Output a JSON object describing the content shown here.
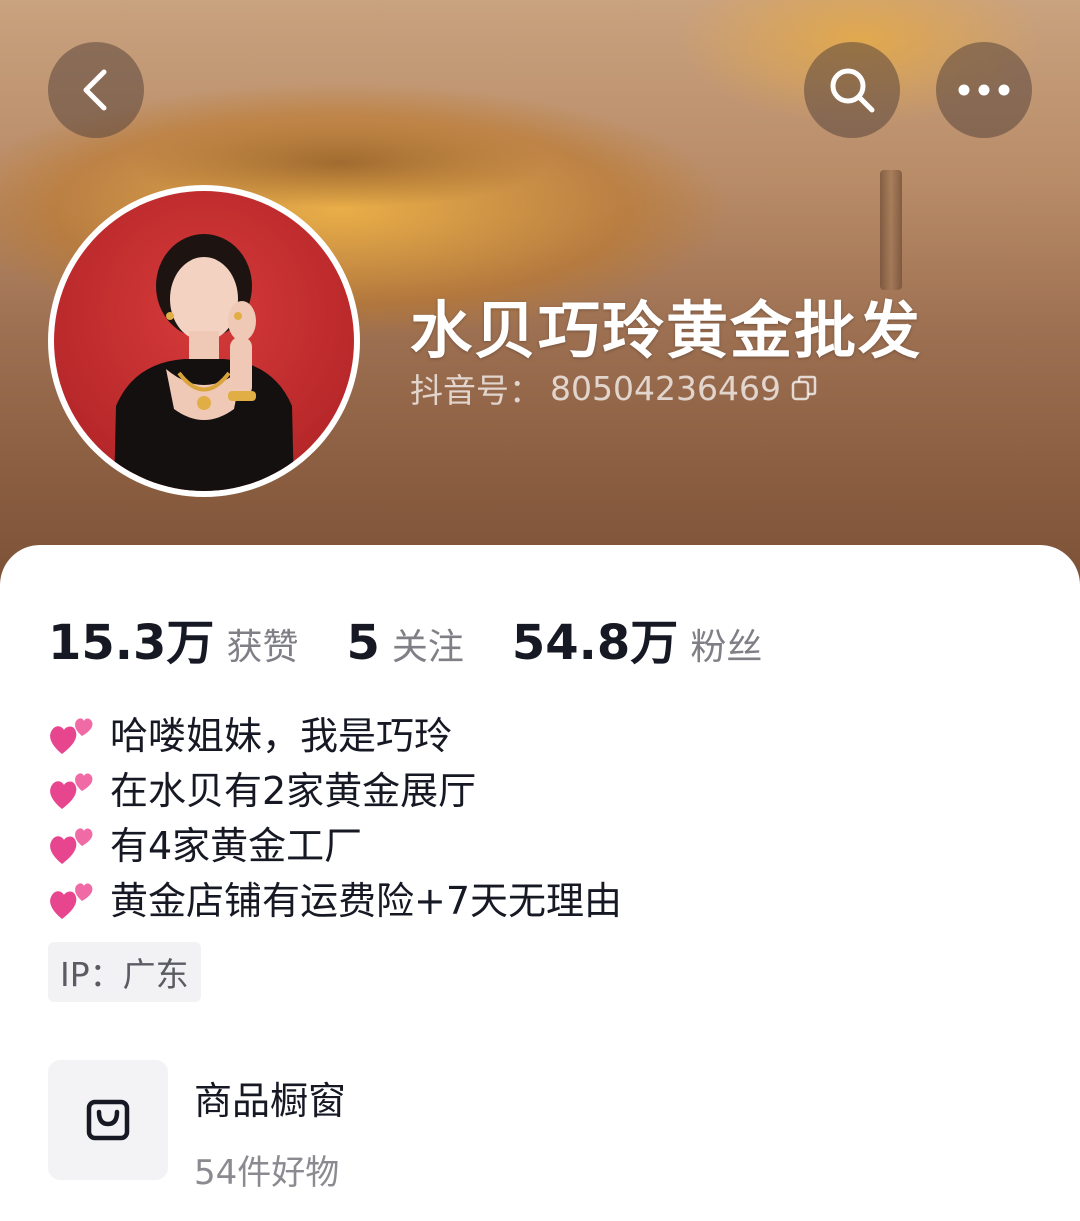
{
  "header": {
    "back_icon": "chevron-left-icon",
    "search_icon": "search-icon",
    "more_icon": "more-horizontal-icon"
  },
  "profile": {
    "name": "水贝巧玲黄金批发",
    "douyin_id_label": "抖音号：",
    "douyin_id": "80504236469",
    "copy_icon": "copy-icon"
  },
  "stats": [
    {
      "value": "15.3万",
      "label": "获赞"
    },
    {
      "value": "5",
      "label": "关注"
    },
    {
      "value": "54.8万",
      "label": "粉丝"
    }
  ],
  "bio": [
    {
      "icon": "two-hearts-icon",
      "text": "哈喽姐妹，我是巧玲"
    },
    {
      "icon": "two-hearts-icon",
      "text": "在水贝有2家黄金展厅"
    },
    {
      "icon": "two-hearts-icon",
      "text": "有4家黄金工厂"
    },
    {
      "icon": "two-hearts-icon",
      "text": "黄金店铺有运费险+7天无理由"
    }
  ],
  "ip": "IP：广东",
  "shop": {
    "icon": "shopping-bag-icon",
    "title": "商品橱窗",
    "subtitle": "54件好物"
  }
}
